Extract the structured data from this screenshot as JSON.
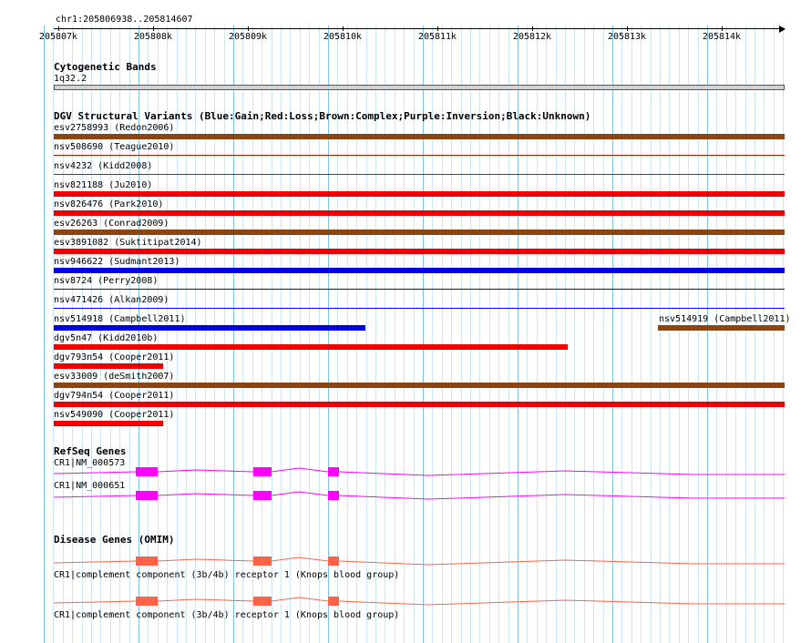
{
  "ruler": {
    "label": "chr1:205806938..205814607",
    "ticks": [
      "205807k",
      "205808k",
      "205809k",
      "205810k",
      "205811k",
      "205812k",
      "205813k",
      "205814k"
    ]
  },
  "cytoband": {
    "title": "Cytogenetic Bands",
    "band": "1q32.2"
  },
  "dgv": {
    "title": "DGV Structural Variants (Blue:Gain;Red:Loss;Brown:Complex;Purple:Inversion;Black:Unknown)",
    "colors": {
      "gain": "#0000e6",
      "loss": "#ee0000",
      "complex": "#8b4513"
    },
    "variants": [
      {
        "label": "esv2758993 (Redon2006)",
        "type": "complex",
        "start": 0.0,
        "end": 1.0,
        "thick": true
      },
      {
        "label": "nsv508690 (Teague2010)",
        "type": "loss",
        "start": 0.0,
        "end": 1.0,
        "thick": false
      },
      {
        "label": "nsv4232 (Kidd2008)",
        "type": "loss",
        "start": 0.0,
        "end": 1.0,
        "thick": false
      },
      {
        "label": "nsv821188 (Ju2010)",
        "type": "loss",
        "start": 0.0,
        "end": 1.0,
        "thick": true
      },
      {
        "label": "nsv826476 (Park2010)",
        "type": "loss",
        "start": 0.0,
        "end": 1.0,
        "thick": true
      },
      {
        "label": "esv26263 (Conrad2009)",
        "type": "complex",
        "start": 0.0,
        "end": 1.0,
        "thick": true
      },
      {
        "label": "esv3891082 (Suktitipat2014)",
        "type": "loss",
        "start": 0.0,
        "end": 1.0,
        "thick": true
      },
      {
        "label": "nsv946622 (Sudmant2013)",
        "type": "gain",
        "start": 0.0,
        "end": 1.0,
        "thick": true
      },
      {
        "label": "nsv8724 (Perry2008)",
        "type": "gain",
        "start": 0.0,
        "end": 1.0,
        "thick": false
      },
      {
        "label": "nsv471426 (Alkan2009)",
        "type": "gain",
        "start": 0.0,
        "end": 1.0,
        "thick": false
      },
      {
        "label": "nsv514918 (Campbell2011)",
        "type": "gain",
        "start": 0.0,
        "end": 0.427,
        "thick": true
      },
      {
        "label": "dgv5n47 (Kidd2010b)",
        "type": "loss",
        "start": 0.0,
        "end": 0.703,
        "thick": true
      },
      {
        "label": "dgv793n54 (Cooper2011)",
        "type": "loss",
        "start": 0.0,
        "end": 0.15,
        "thick": true
      },
      {
        "label": "esv33009 (deSmith2007)",
        "type": "complex",
        "start": 0.0,
        "end": 1.0,
        "thick": true
      },
      {
        "label": "dgv794n54 (Cooper2011)",
        "type": "loss",
        "start": 0.0,
        "end": 1.0,
        "thick": true
      },
      {
        "label": "nsv549090 (Cooper2011)",
        "type": "loss",
        "start": 0.0,
        "end": 0.15,
        "thick": true
      }
    ],
    "side_variant": {
      "label": "nsv514919 (Campbell2011)",
      "type": "complex",
      "start": 0.827,
      "end": 1.0
    }
  },
  "refseq": {
    "title": "RefSeq Genes",
    "color": "#ff00ff",
    "genes": [
      {
        "label": "CR1|NM_000573"
      },
      {
        "label": "CR1|NM_000651"
      }
    ]
  },
  "omim": {
    "title": "Disease Genes (OMIM)",
    "color": "#ff6347",
    "genes": [
      {
        "label": "CR1|complement component (3b/4b) receptor 1 (Knops blood group)"
      },
      {
        "label": "CR1|complement component (3b/4b) receptor 1 (Knops blood group)"
      }
    ]
  }
}
